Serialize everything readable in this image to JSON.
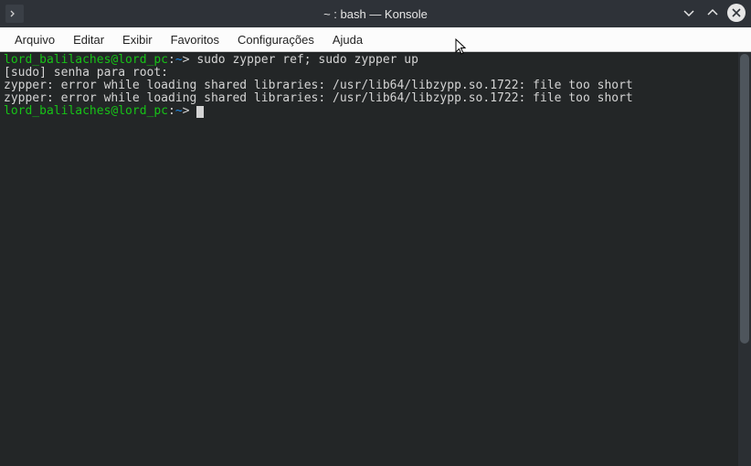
{
  "titlebar": {
    "title": "~ : bash — Konsole"
  },
  "menu": {
    "items": [
      "Arquivo",
      "Editar",
      "Exibir",
      "Favoritos",
      "Configurações",
      "Ajuda"
    ]
  },
  "terminal": {
    "prompt_user": "lord_balilaches@lord_pc",
    "prompt_sep": ":",
    "prompt_path": "~",
    "prompt_end": ">",
    "cmd1": " sudo zypper ref; sudo zypper up",
    "line_sudo_prefix": "[sudo] senha para root:",
    "err1": "zypper: error while loading shared libraries: /usr/lib64/libzypp.so.1722: file too short",
    "err2": "zypper: error while loading shared libraries: /usr/lib64/libzypp.so.1722: file too short"
  }
}
